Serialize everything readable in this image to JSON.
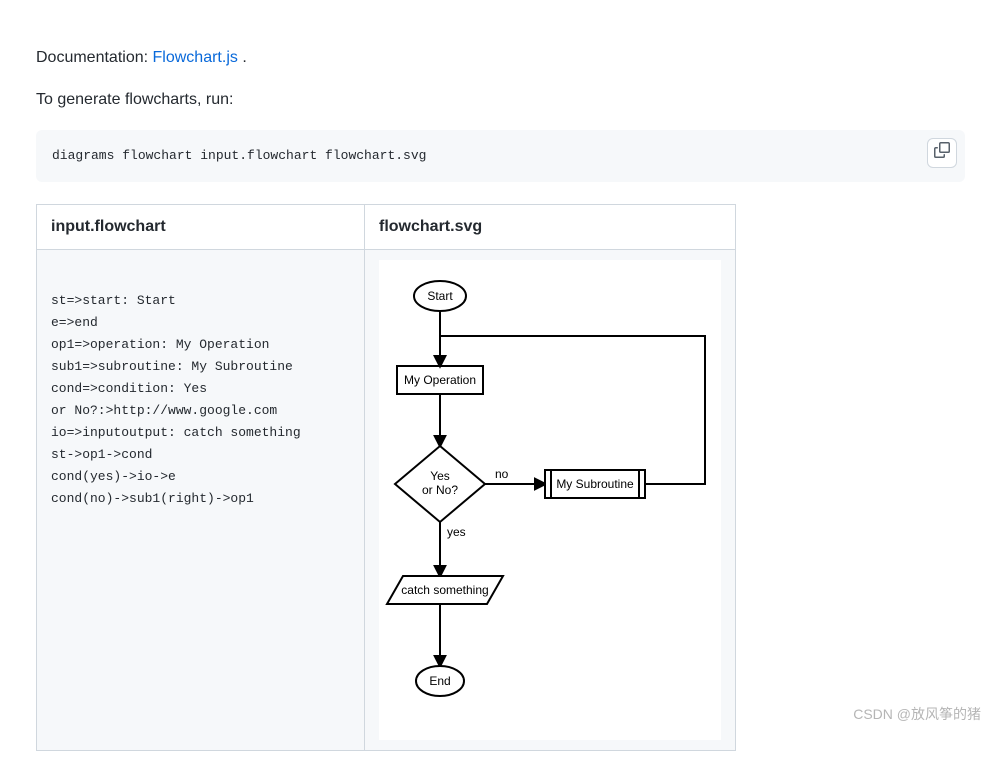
{
  "intro": {
    "doc_prefix": "Documentation: ",
    "doc_link_text": "Flowchart.js",
    "doc_suffix": " .",
    "generate_text": "To generate flowcharts, run:"
  },
  "command": "diagrams flowchart input.flowchart flowchart.svg",
  "table": {
    "header_left": "input.flowchart",
    "header_right": "flowchart.svg",
    "source_lines": [
      "st=>start: Start",
      "e=>end",
      "op1=>operation: My Operation",
      "sub1=>subroutine: My Subroutine",
      "cond=>condition: Yes",
      "or No?:>http://www.google.com",
      "io=>inputoutput: catch something",
      "st->op1->cond",
      "cond(yes)->io->e",
      "cond(no)->sub1(right)->op1"
    ]
  },
  "flowchart": {
    "start": "Start",
    "operation": "My Operation",
    "condition_line1": "Yes",
    "condition_line2": "or No?",
    "cond_yes_label": "yes",
    "cond_no_label": "no",
    "subroutine": "My Subroutine",
    "io": "catch something",
    "end": "End"
  },
  "watermark": "CSDN @放风筝的猪"
}
